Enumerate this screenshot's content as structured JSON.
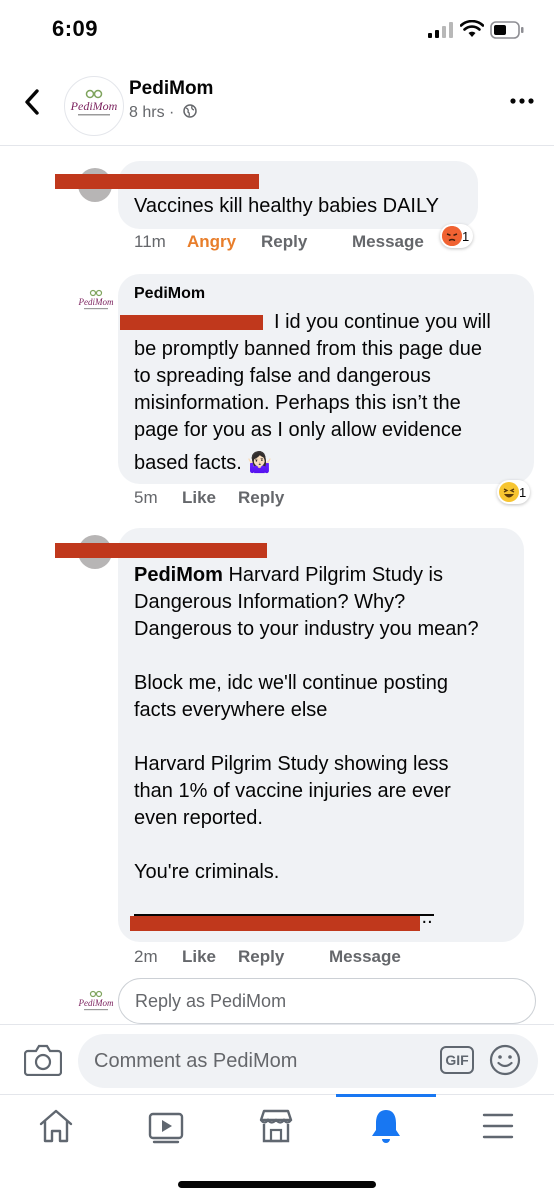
{
  "status_bar": {
    "time": "6:09"
  },
  "header": {
    "page_name": "PediMom",
    "post_time": "8 hrs ·"
  },
  "comments": [
    {
      "text": "Vaccines kill healthy babies DAILY",
      "time": "11m",
      "reaction_label": "Angry",
      "reply_label": "Reply",
      "message_label": "Message",
      "reaction_count": "1",
      "reaction_icon": "angry-emoji-icon"
    },
    {
      "author": "PediMom",
      "text_lines": [
        "I id you continue you will",
        "be promptly banned from this page due",
        "to spreading false and dangerous",
        "misinformation. Perhaps this isn’t the",
        "page for you as I only allow evidence",
        "based facts. 🤷🏻‍♀️"
      ],
      "time": "5m",
      "like_label": "Like",
      "reply_label": "Reply",
      "reaction_count": "1",
      "reaction_icon": "laughing-emoji-icon"
    },
    {
      "mention": "PediMom",
      "first_line_rest": " Harvard Pilgrim Study is",
      "text_lines": [
        "Dangerous Information? Why?",
        "Dangerous to your industry you mean?",
        "",
        "Block me, idc we'll continue posting",
        "facts everywhere else",
        "",
        "Harvard Pilgrim Study showing less",
        "than 1% of vaccine injuries are ever",
        "even reported.",
        "",
        "You're criminals."
      ],
      "link_ellipsis": "...",
      "time": "2m",
      "like_label": "Like",
      "reply_label": "Reply",
      "message_label": "Message"
    }
  ],
  "reply_box": {
    "placeholder": "Reply as PediMom"
  },
  "comment_bar": {
    "placeholder": "Comment as PediMom",
    "gif_label": "GIF"
  },
  "logo_text": {
    "main": "PediMom"
  },
  "colors": {
    "accent": "#1877f2",
    "angry": "#e87e2b",
    "redaction": "#c0381c",
    "bubble": "#f0f2f5"
  }
}
